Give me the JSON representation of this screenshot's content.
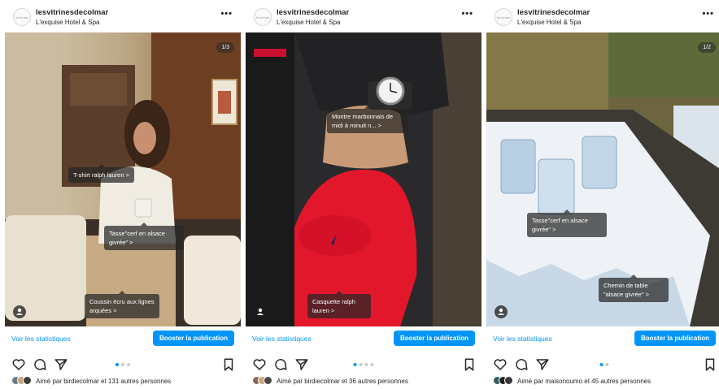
{
  "posts": [
    {
      "username": "lesvitrinesdecolmar",
      "location": "L'exquise Hotel & Spa",
      "avatar_text": "lesvitrines",
      "counter": "1/3",
      "tags": [
        {
          "text": "T-shirt ralph lauren >"
        },
        {
          "text": "Tasse\"cerf en alsace givrée\" >"
        },
        {
          "text": "Coussin écru aux lignes arquées >"
        }
      ],
      "stats_link": "Voir les statistiques",
      "boost_label": "Booster la publication",
      "likes_text": "Aimé par birdiecolmar et 131 autres personnes",
      "dots_count": 3,
      "active_dot": 0,
      "avatar_colors": [
        "#6b7a8c",
        "#c9a27c",
        "#3e3e3e"
      ]
    },
    {
      "username": "lesvitrinesdecolmar",
      "location": "L'exquise Hotel & Spa",
      "avatar_text": "lesvitrines",
      "counter": "",
      "tags": [
        {
          "text": "Montre marbonnais de midi à minuit n... >"
        },
        {
          "text": "Casquette ralph lauren >"
        }
      ],
      "stats_link": "Voir les statistiques",
      "boost_label": "Booster la publication",
      "likes_text": "Aimé par birdiecolmar et 36 autres personnes",
      "dots_count": 4,
      "active_dot": 0,
      "avatar_colors": [
        "#8a6a52",
        "#c9a27c",
        "#4a4a4a"
      ]
    },
    {
      "username": "lesvitrinesdecolmar",
      "location": "L'exquise Hotel & Spa",
      "avatar_text": "lesvitrines",
      "counter": "1/2",
      "tags": [
        {
          "text": "Tasse\"cerf en alsace givrée\" >"
        },
        {
          "text": "Chemin de table \"alsace givrée\" >"
        }
      ],
      "stats_link": "Voir les statistiques",
      "boost_label": "Booster la publication",
      "likes_text": "Aimé par maisonoumo et 45 autres personnes",
      "dots_count": 2,
      "active_dot": 0,
      "avatar_colors": [
        "#2f5b5b",
        "#222222",
        "#3a3a3a"
      ]
    }
  ],
  "icons": {
    "like": "heart-icon",
    "comment": "comment-icon",
    "share": "send-icon",
    "save": "bookmark-icon",
    "tagged_people": "person-icon"
  },
  "colors": {
    "accent": "#0095f6",
    "text": "#262626"
  }
}
